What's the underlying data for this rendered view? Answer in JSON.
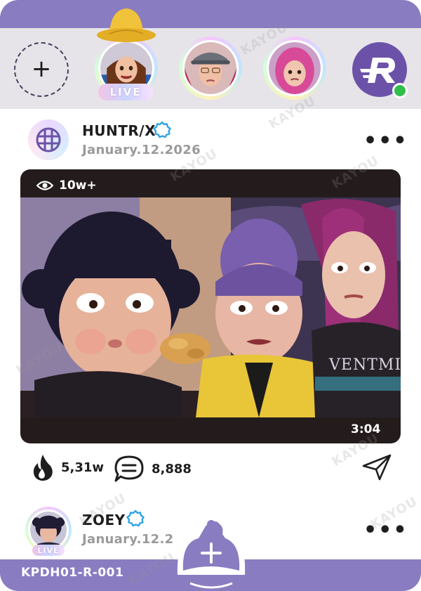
{
  "stories": {
    "add_symbol": "+",
    "live_label": "LIVE",
    "items": [
      {
        "name": "rumi-story",
        "live": true
      },
      {
        "name": "mira-story",
        "live": false
      },
      {
        "name": "zoey-story",
        "live": false
      }
    ],
    "brand_logo_letter": "R",
    "online_status_color": "#2fbf4a"
  },
  "post": {
    "author": "HUNTR/X",
    "verified": true,
    "date": "January.12.2026",
    "more_label": "•••",
    "views": "10w+",
    "duration": "3:04",
    "likes": "5,31w",
    "comments": "8,888"
  },
  "next_post": {
    "author": "ZOEY",
    "verified": true,
    "date": "January.12.2",
    "live_label": "LIVE",
    "more_label": "•••"
  },
  "footer": {
    "card_code": "KPDH01-R-001",
    "fab_symbol": "+"
  },
  "watermark_text": "KAYOU",
  "colors": {
    "brand_purple": "#8a7cc1",
    "logo_purple": "#6b52a8",
    "verified_blue": "#2fa4e7",
    "story_bar_gray": "#e6e4e8"
  }
}
